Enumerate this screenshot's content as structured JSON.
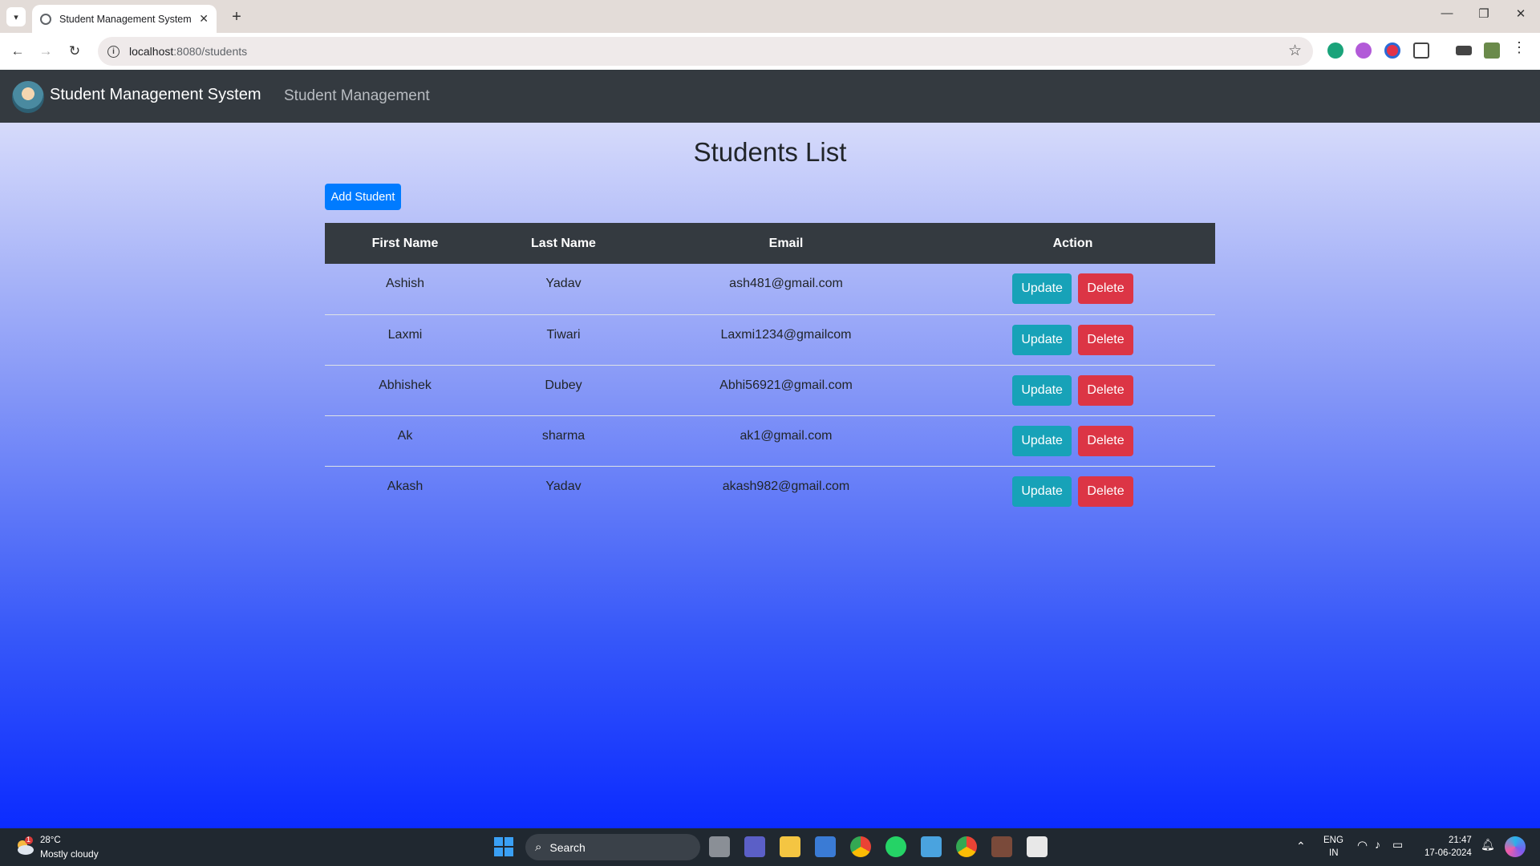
{
  "browser": {
    "tab_title": "Student Management System",
    "url_host": "localhost",
    "url_path": ":8080/students"
  },
  "navbar": {
    "brand": "Student Management System",
    "link": "Student Management"
  },
  "main": {
    "heading": "Students List",
    "add_button": "Add Student",
    "table": {
      "headers": [
        "First Name",
        "Last Name",
        "Email",
        "Action"
      ],
      "rows": [
        {
          "first": "Ashish",
          "last": "Yadav",
          "email": "ash481@gmail.com"
        },
        {
          "first": "Laxmi",
          "last": "Tiwari",
          "email": "Laxmi1234@gmailcom"
        },
        {
          "first": "Abhishek",
          "last": "Dubey",
          "email": "Abhi56921@gmail.com"
        },
        {
          "first": "Ak",
          "last": "sharma",
          "email": "ak1@gmail.com"
        },
        {
          "first": "Akash",
          "last": "Yadav",
          "email": "akash982@gmail.com"
        }
      ],
      "update_label": "Update",
      "delete_label": "Delete"
    }
  },
  "taskbar": {
    "weather_temp": "28°C",
    "weather_desc": "Mostly cloudy",
    "weather_badge": "1",
    "search_label": "Search",
    "lang": "ENG",
    "region": "IN",
    "time": "21:47",
    "date": "17-06-2024"
  },
  "colors": {
    "navbar_bg": "#343a40",
    "primary": "#007bff",
    "info": "#17a2b8",
    "danger": "#dc3545"
  }
}
